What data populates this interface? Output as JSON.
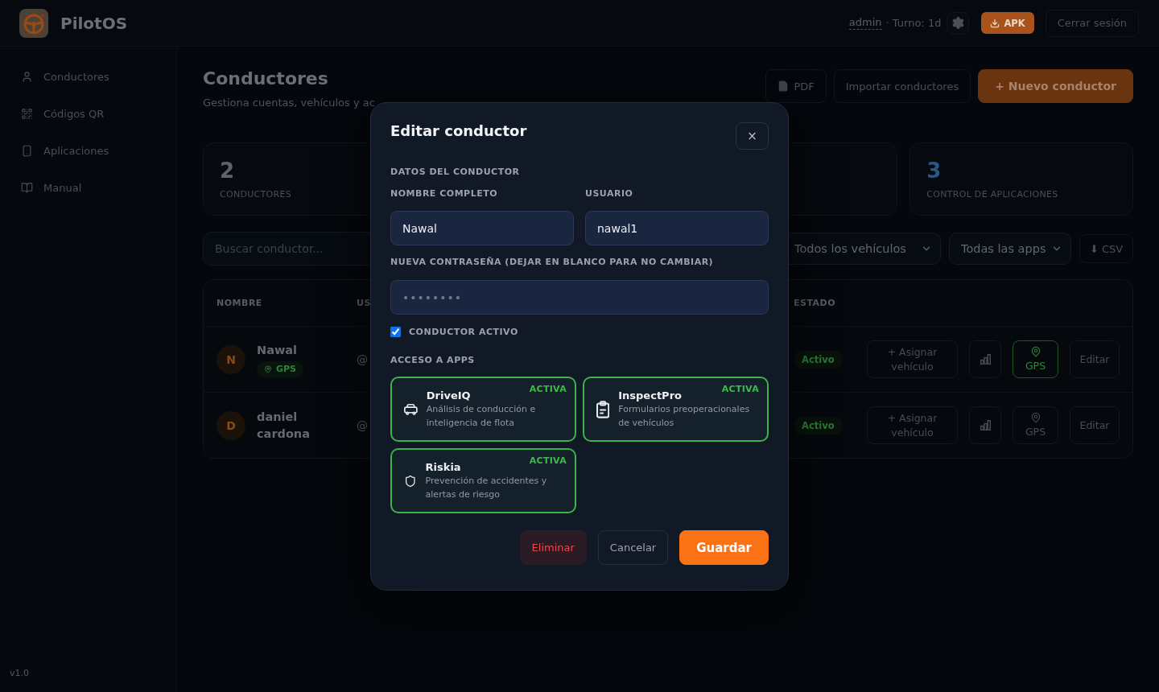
{
  "topbar": {
    "brand": "PilotOS",
    "user": "admin",
    "shift": "· Turno: 1d",
    "apk_button": "APK",
    "logout_button": "Cerrar sesión"
  },
  "sidebar": {
    "items": [
      {
        "label": "Conductores",
        "selected": false
      },
      {
        "label": "Códigos QR",
        "selected": false
      },
      {
        "label": "Aplicaciones",
        "selected": false
      },
      {
        "label": "Manual",
        "selected": false
      }
    ],
    "version": "v1.0"
  },
  "page": {
    "title": "Conductores",
    "subtitle": "Gestiona cuentas, vehículos y ac",
    "actions": [
      {
        "label": "PDF",
        "kind": "document"
      },
      {
        "label": "Importar conductores",
        "kind": "secondary"
      },
      {
        "label": "+ Nuevo conductor",
        "kind": "primary"
      }
    ]
  },
  "stats": [
    {
      "value": "2",
      "label": "CONDUCTORES",
      "color": "#5f636a"
    },
    {
      "value": "3",
      "label": "CONTROL DE APLICACIONES",
      "color": "#2b5686"
    }
  ],
  "filters": {
    "search": {
      "placeholder": "Buscar conductor..."
    },
    "selects": [
      {
        "value": "Todos los vehículos"
      },
      {
        "value": "Todas las apps"
      }
    ],
    "export_button": "⬇ CSV"
  },
  "table": {
    "columns": [
      "NOMBRE",
      "US",
      "ESTADO"
    ],
    "rows": [
      {
        "initial": "N",
        "name": "Nawal",
        "badge": "GPS",
        "user": "@",
        "status": "Activo",
        "assign_button": "+ Asignar vehículo",
        "gps_button": "GPS",
        "gps_on": true,
        "edit_button": "Editar"
      },
      {
        "initial": "D",
        "name": "daniel cardona",
        "user": "@",
        "status": "Activo",
        "assign_button": "+ Asignar vehículo",
        "gps_button": "GPS",
        "gps_on": false,
        "edit_button": "Editar"
      }
    ]
  },
  "dialog": {
    "title": "Editar conductor",
    "close": "×",
    "section": "DATOS DEL CONDUCTOR",
    "fields": [
      {
        "label": "NOMBRE COMPLETO",
        "value": "Nawal"
      },
      {
        "label": "USUARIO",
        "value": "nawal1"
      }
    ],
    "password": {
      "label": "NUEVA CONTRASEÑA (DEJAR EN BLANCO PARA NO CAMBIAR)",
      "placeholder": "••••••••"
    },
    "active": {
      "label": "CONDUCTOR ACTIVO",
      "checked": true
    },
    "apps_title": "ACCESO A APPS",
    "apps": [
      {
        "name": "DriveIQ",
        "description": "Análisis de conducción e inteligencia de flota",
        "badge": "ACTIVA",
        "enabled": true
      },
      {
        "name": "InspectPro",
        "description": "Formularios preoperacionales de vehículos",
        "badge": "ACTIVA",
        "enabled": true
      },
      {
        "name": "Riskia",
        "description": "Prevención de accidentes y alertas de riesgo",
        "badge": "ACTIVA",
        "enabled": true
      }
    ],
    "buttons": [
      {
        "label": "Eliminar",
        "kind": "danger"
      },
      {
        "label": "Cancelar",
        "kind": "secondary"
      },
      {
        "label": "Guardar",
        "kind": "primary"
      }
    ]
  }
}
